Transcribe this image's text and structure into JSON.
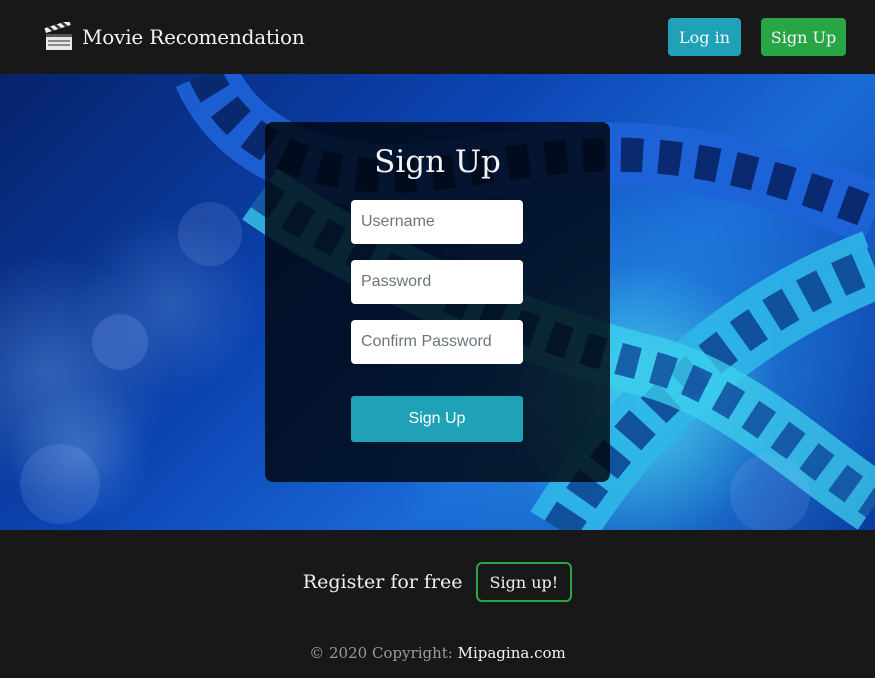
{
  "navbar": {
    "brand_title": "Movie Recomendation",
    "brand_icon": "clapperboard-icon",
    "login_label": "Log in",
    "signup_label": "Sign Up",
    "login_color": "#1fa2b8",
    "signup_color": "#28a645"
  },
  "form": {
    "title": "Sign Up",
    "username_placeholder": "Username",
    "password_placeholder": "Password",
    "confirm_placeholder": "Confirm Password",
    "submit_label": "Sign Up"
  },
  "footer": {
    "register_text": "Register for free",
    "register_button": "Sign up!",
    "copyright_text": "© 2020 Copyright: ",
    "copyright_link": "Mipagina.com"
  },
  "colors": {
    "background": "#181818",
    "accent_teal": "#1fa2b8",
    "accent_green": "#28a645"
  }
}
